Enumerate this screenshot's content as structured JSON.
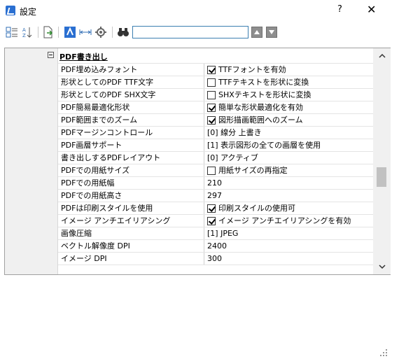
{
  "window": {
    "title": "設定",
    "help": "?",
    "close": "✕"
  },
  "toolbar": {
    "search_value": ""
  },
  "section": {
    "title": "PDF書き出し"
  },
  "rows": [
    {
      "name": "PDF埋め込みフォント",
      "value": "TTFフォントを有効",
      "checkbox": true,
      "checked": true
    },
    {
      "name": "形状としてのPDF TTF文字",
      "value": "TTFテキストを形状に変換",
      "checkbox": true,
      "checked": false
    },
    {
      "name": "形状としてのPDF SHX文字",
      "value": "SHXテキストを形状に変換",
      "checkbox": true,
      "checked": false
    },
    {
      "name": "PDF簡易最適化形状",
      "value": "簡単な形状最適化を有効",
      "checkbox": true,
      "checked": true
    },
    {
      "name": "PDF範囲までのズーム",
      "value": "図形描画範囲へのズーム",
      "checkbox": true,
      "checked": true
    },
    {
      "name": "PDFマージンコントロール",
      "value": "[0] 線分 上書き",
      "checkbox": false
    },
    {
      "name": "PDF画層サポート",
      "value": "[1] 表示図形の全ての画層を使用",
      "checkbox": false
    },
    {
      "name": "書き出しするPDFレイアウト",
      "value": "[0] アクティブ",
      "checkbox": false
    },
    {
      "name": "PDFでの用紙サイズ",
      "value": "用紙サイズの再指定",
      "checkbox": true,
      "checked": false
    },
    {
      "name": "PDFでの用紙幅",
      "value": "210",
      "checkbox": false
    },
    {
      "name": "PDFでの用紙高さ",
      "value": "297",
      "checkbox": false
    },
    {
      "name": "PDFは印刷スタイルを使用",
      "value": "印刷スタイルの使用可",
      "checkbox": true,
      "checked": true
    },
    {
      "name": "イメージ アンチエイリアシング",
      "value": "イメージ アンチエイリアシングを有効",
      "checkbox": true,
      "checked": true
    },
    {
      "name": "画像圧縮",
      "value": "[1] JPEG",
      "checkbox": false
    },
    {
      "name": "ベクトル解像度 DPI",
      "value": "2400",
      "checkbox": false
    },
    {
      "name": "イメージ DPI",
      "value": "300",
      "checkbox": false
    }
  ],
  "scroll_fraction": 0.59
}
